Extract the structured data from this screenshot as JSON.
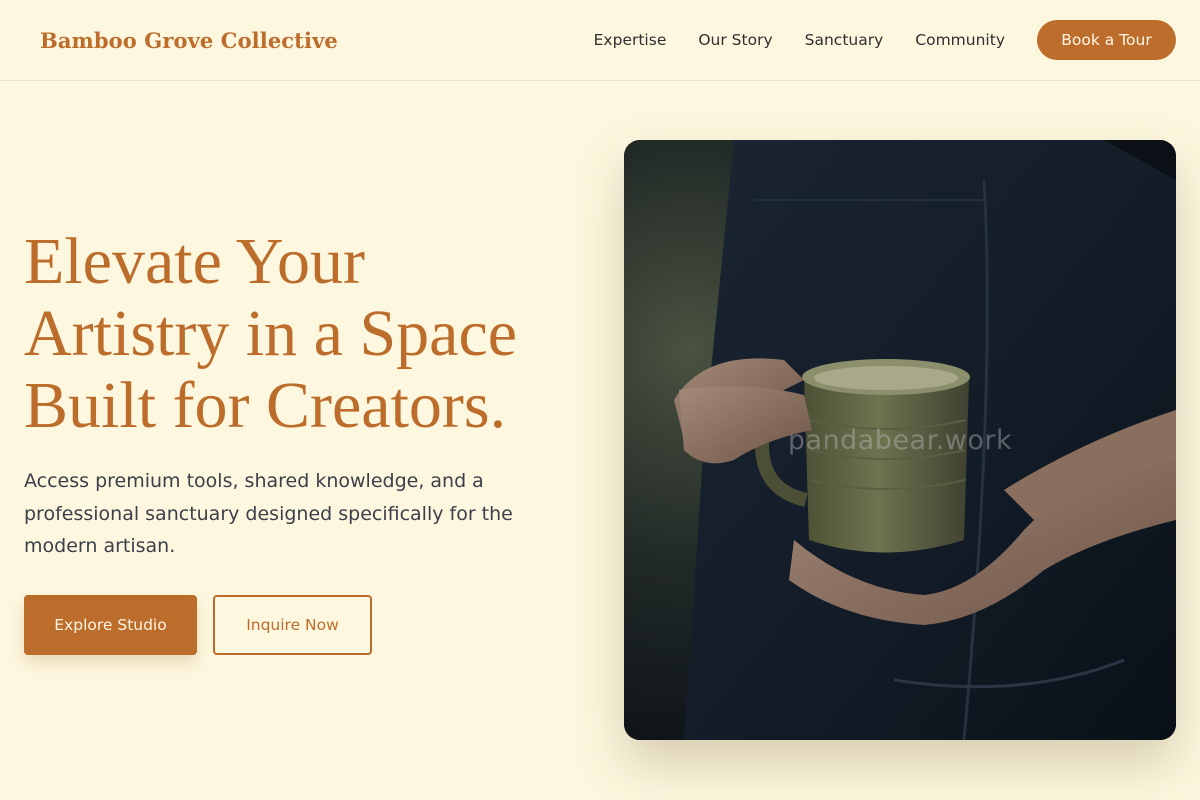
{
  "header": {
    "brand": "Bamboo Grove Collective",
    "nav": [
      {
        "label": "Expertise"
      },
      {
        "label": "Our Story"
      },
      {
        "label": "Sanctuary"
      },
      {
        "label": "Community"
      }
    ],
    "cta_label": "Book a Tour"
  },
  "hero": {
    "title_lines": [
      "Elevate Your",
      "Artistry in a Space",
      "Built for Creators."
    ],
    "subtitle": "Access premium tools, shared knowledge, and a professional sanctuary designed specifically for the modern artisan.",
    "primary_button": "Explore Studio",
    "secondary_button": "Inquire Now",
    "image": {
      "watermark": "pandabear.work"
    }
  },
  "colors": {
    "background": "#fdf7df",
    "accent": "#bd6d2b",
    "text": "#3b3f4a"
  }
}
